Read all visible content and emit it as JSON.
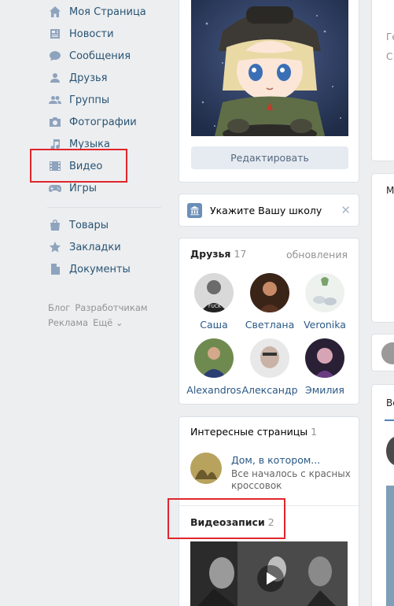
{
  "sidebar": {
    "items": [
      {
        "label": "Моя Страница",
        "icon": "home-icon"
      },
      {
        "label": "Новости",
        "icon": "news-icon"
      },
      {
        "label": "Сообщения",
        "icon": "messages-icon"
      },
      {
        "label": "Друзья",
        "icon": "friends-icon"
      },
      {
        "label": "Группы",
        "icon": "groups-icon"
      },
      {
        "label": "Фотографии",
        "icon": "camera-icon"
      },
      {
        "label": "Музыка",
        "icon": "music-icon"
      },
      {
        "label": "Видео",
        "icon": "video-icon"
      },
      {
        "label": "Игры",
        "icon": "gamepad-icon"
      },
      {
        "label": "Товары",
        "icon": "bag-icon"
      },
      {
        "label": "Закладки",
        "icon": "star-icon"
      },
      {
        "label": "Документы",
        "icon": "document-icon"
      }
    ],
    "footer": [
      "Блог",
      "Разработчикам",
      "Реклама",
      "Ещё ⌄"
    ]
  },
  "profile": {
    "edit_label": "Редактировать"
  },
  "school": {
    "prompt": "Укажите Вашу школу",
    "close": "✕"
  },
  "friends": {
    "title": "Друзья",
    "count": "17",
    "updates_label": "обновления",
    "list": [
      {
        "name": "Саша"
      },
      {
        "name": "Светлана"
      },
      {
        "name": "Veronika"
      },
      {
        "name": "Alexandros"
      },
      {
        "name": "Александр"
      },
      {
        "name": "Эмилия"
      }
    ]
  },
  "interesting": {
    "title": "Интересные страницы",
    "count": "1",
    "item_title": "Дом, в котором...",
    "item_desc": "Все началось с красных кроссовок"
  },
  "videos": {
    "title": "Видеозаписи",
    "count": "2"
  },
  "right": {
    "t1": "Ге",
    "t2": "С",
    "t3": "М",
    "t4": "Вс"
  },
  "colors": {
    "highlight": "#e0262c",
    "link": "#2a5885",
    "nav_text": "#285473",
    "background": "#edeef0"
  }
}
